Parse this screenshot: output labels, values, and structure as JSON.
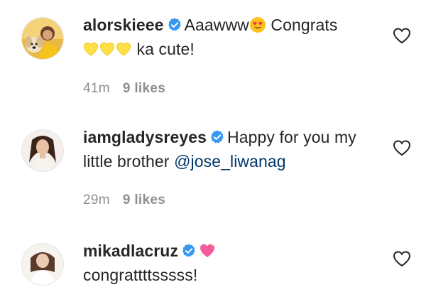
{
  "comments": [
    {
      "username": "alorskieee",
      "text_before_emoji": "Aaawww",
      "text_after_emoji": " Congrats",
      "text_after_hearts": " ka cute!",
      "time": "41m",
      "likes": "9 likes",
      "emoji": [
        "heart-eyes-emoji",
        "yellow-heart-emoji",
        "yellow-heart-emoji",
        "yellow-heart-emoji"
      ]
    },
    {
      "username": "iamgladysreyes",
      "text": "Happy for you my little brother ",
      "mention": "@jose_liwanag",
      "time": "29m",
      "likes": "9 likes"
    },
    {
      "username": "mikadlacruz",
      "text": "congrattttsssss!",
      "emoji": [
        "sparkling-heart-emoji"
      ]
    }
  ],
  "colors": {
    "username": "#262626",
    "meta": "#8e8e8e",
    "verified_badge": "#3897f0",
    "mention": "#00376b",
    "like_outline": "#262626"
  },
  "icons": {
    "verified": "verified-badge-icon",
    "like": "heart-outline-icon"
  }
}
